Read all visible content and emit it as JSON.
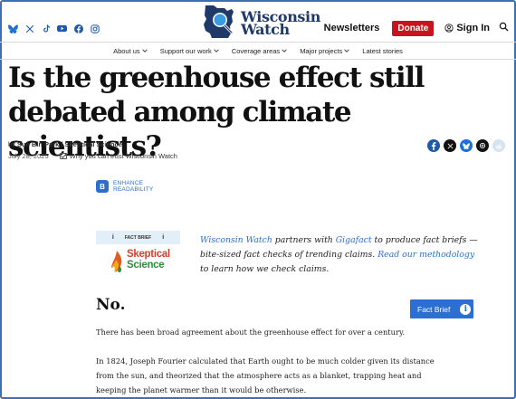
{
  "header": {
    "socials": [
      "bluesky-icon",
      "x-icon",
      "tiktok-icon",
      "youtube-icon",
      "facebook-icon",
      "instagram-icon"
    ],
    "logo_line1": "Wisconsin",
    "logo_line2": "Watch",
    "newsletters": "Newsletters",
    "donate": "Donate",
    "signin": "Sign In"
  },
  "nav": {
    "items": [
      {
        "label": "About us"
      },
      {
        "label": "Support our work"
      },
      {
        "label": "Coverage areas"
      },
      {
        "label": "Major projects"
      },
      {
        "label": "Latest stories"
      }
    ]
  },
  "article": {
    "headline": "Is the greenhouse effect still debated among climate scientists?",
    "byline_prefix": "by",
    "byline_author": "Sue Bin Park / Skeptical Science",
    "date": "July 28, 2025",
    "trust_text": "Why you can trust Wisconsin Watch",
    "enhance_line1": "ENHANCE",
    "enhance_line2": "READABILITY",
    "fact_brief_tag": "FACT BRIEF",
    "sk_line1": "Skeptical",
    "sk_line2": "Science",
    "desc_link1": "Wisconsin Watch",
    "desc_part1": " partners with ",
    "desc_link2": "Gigafact",
    "desc_part2": " to produce fact briefs — bite-sized fact checks of trending claims. ",
    "desc_link3": "Read our methodology",
    "desc_part3": " to learn how we check claims.",
    "answer": "No.",
    "fact_brief_button": "Fact Brief",
    "para1": "There has been broad agreement about the greenhouse effect for over a century.",
    "para2": "In 1824, Joseph Fourier calculated that Earth ought to be much colder given its distance from the sun, and theorized that the atmosphere acts as a blanket, trapping heat and keeping the planet warmer than it would be otherwise."
  },
  "colors": {
    "brand_blue": "#1f3a68",
    "accent_blue": "#2a6fd1",
    "donate_red": "#c8141e",
    "skeptical_green": "#2f8d3a"
  }
}
